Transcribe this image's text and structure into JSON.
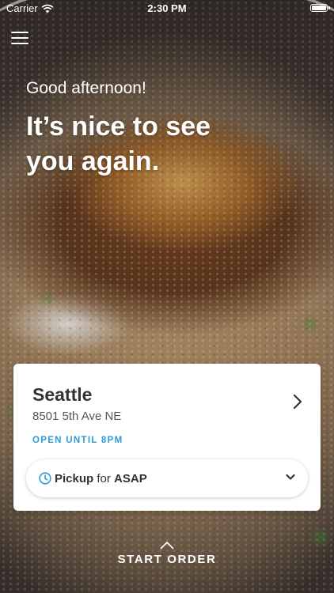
{
  "status_bar": {
    "carrier": "Carrier",
    "time": "2:30 PM",
    "battery_level": 1.0
  },
  "header": {
    "greeting": "Good afternoon!",
    "headline": "It’s nice to see you again."
  },
  "location_card": {
    "store_name": "Seattle",
    "address": "8501 5th Ave NE",
    "hours": "OPEN UNTIL 8PM",
    "pickup": {
      "mode": "Pickup",
      "connector": "for",
      "time": "ASAP"
    }
  },
  "footer": {
    "start_order_label": "START ORDER"
  },
  "icons": {
    "menu": "hamburger-icon",
    "wifi": "wifi-icon",
    "battery": "battery-icon",
    "store_chevron": "chevron-right-icon",
    "clock": "clock-icon",
    "select_chevron": "chevron-down-icon",
    "start_order": "chevron-up-icon"
  },
  "colors": {
    "accent": "#2b9bd6",
    "card_background": "#ffffff",
    "text_dark": "#333333"
  }
}
